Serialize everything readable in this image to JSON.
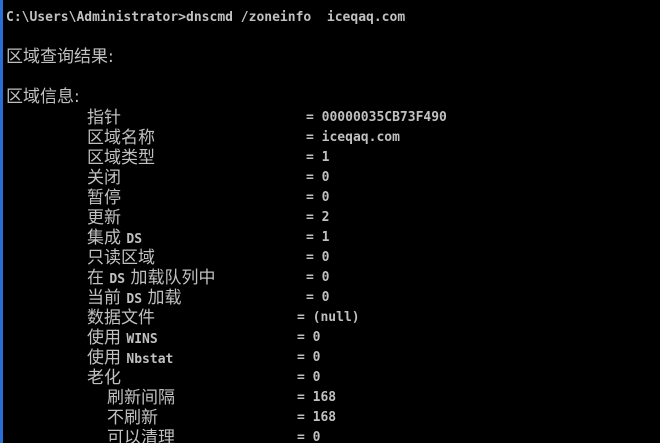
{
  "theme": {
    "background": "#000000",
    "foreground": "#c0c0c0",
    "edge_accent": "#2a6fd6"
  },
  "prompt": {
    "command_line": "C:\\Users\\Administrator>dnscmd /zoneinfo  iceqaq.com"
  },
  "result_heading": "区域查询结果:",
  "info_heading": "区域信息:",
  "fields": [
    {
      "key": "指针",
      "value": "= 00000035CB73F490"
    },
    {
      "key": "区域名称",
      "value": "= iceqaq.com"
    },
    {
      "key": "区域类型",
      "value": "= 1"
    },
    {
      "key": "关闭",
      "value": "= 0"
    },
    {
      "key": "暂停",
      "value": "= 0"
    },
    {
      "key": "更新",
      "value": "= 2"
    },
    {
      "key": "集成 DS",
      "value": "= 1"
    },
    {
      "key": "只读区域",
      "value": "= 0"
    },
    {
      "key": "在 DS 加载队列中",
      "value": "= 0"
    },
    {
      "key": "当前 DS 加载",
      "value": "= 0"
    },
    {
      "key": "数据文件",
      "value": "= (null)"
    },
    {
      "key": "使用 WINS",
      "value": "= 0"
    },
    {
      "key": "使用 Nbstat",
      "value": "= 0"
    },
    {
      "key": "老化",
      "value": "= 0"
    },
    {
      "key": "刷新间隔",
      "value": "= 168"
    },
    {
      "key": "不刷新",
      "value": "= 168"
    },
    {
      "key": "可以清理",
      "value": "= 0"
    }
  ]
}
